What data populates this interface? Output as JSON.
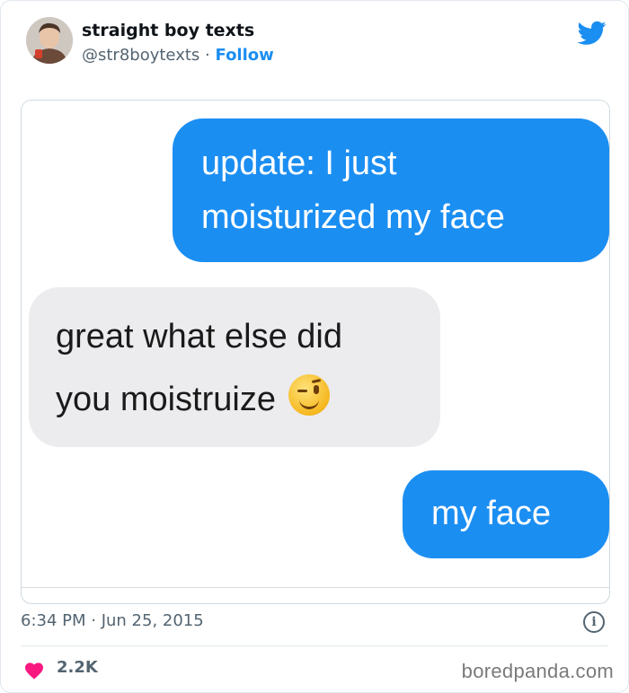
{
  "tweet": {
    "display_name": "straight boy texts",
    "handle": "@str8boytexts",
    "separator": "·",
    "follow_label": "Follow",
    "timestamp": "6:34 PM · Jun 25, 2015",
    "likes": "2.2K",
    "info_icon": "info-icon",
    "like_icon": "heart-icon",
    "brand_icon": "twitter-bird-icon"
  },
  "conversation": {
    "messages": [
      {
        "sender": "me",
        "line1": "update: I just",
        "line2": "moisturized my face"
      },
      {
        "sender": "them",
        "line1": "great what else did",
        "line2": "you moistruize",
        "emoji": "winking-face-emoji"
      },
      {
        "sender": "me",
        "line1": "my face"
      }
    ]
  },
  "watermark": "boredpanda.com",
  "colors": {
    "accent": "#1b8ef2",
    "outgoing_bubble": "#1b8ef2",
    "incoming_bubble": "#ececef",
    "heart": "#f91880",
    "muted_text": "#536471"
  }
}
